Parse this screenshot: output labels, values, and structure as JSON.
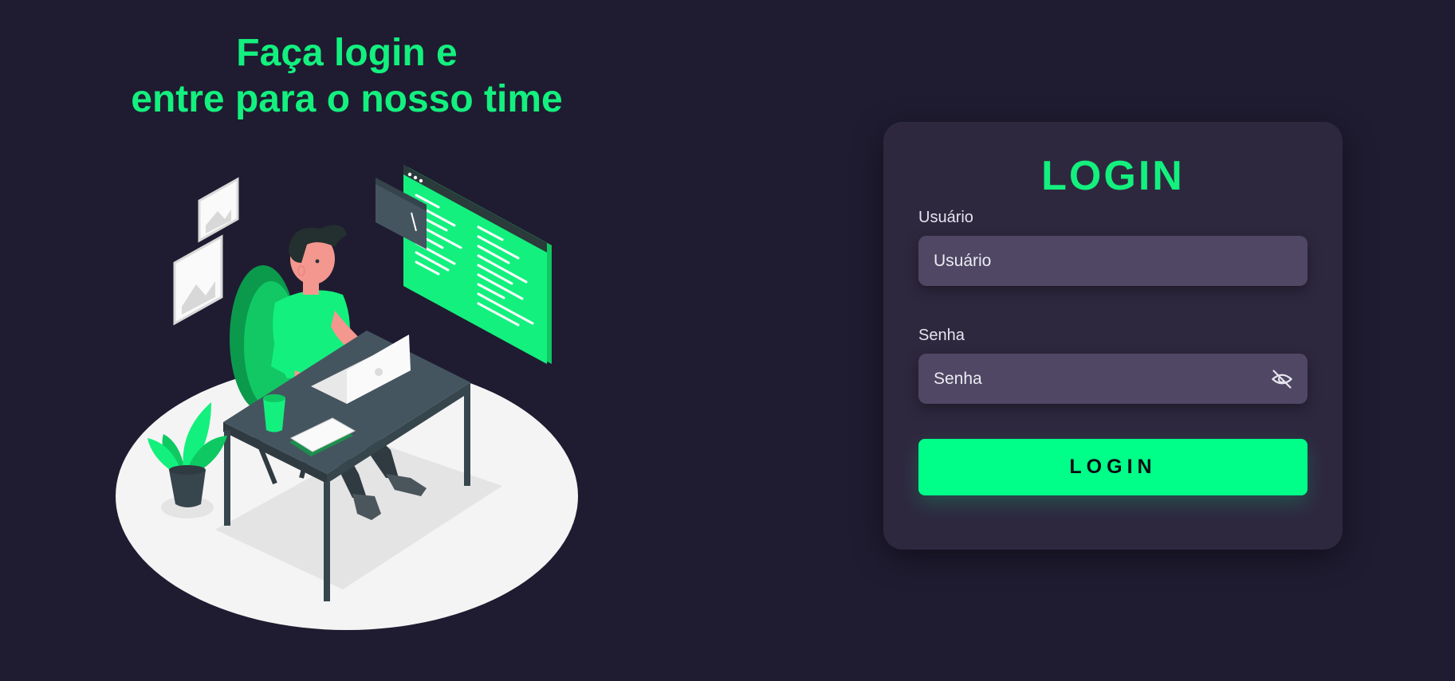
{
  "hero": {
    "line1": "Faça login e",
    "line2": "entre para o nosso time"
  },
  "login_card": {
    "title": "LOGIN",
    "username": {
      "label": "Usuário",
      "placeholder": "Usuário",
      "value": ""
    },
    "password": {
      "label": "Senha",
      "placeholder": "Senha",
      "value": "",
      "toggle_icon": "eye-off-icon"
    },
    "submit_label": "LOGIN"
  },
  "colors": {
    "background": "#1f1c31",
    "card": "#2e283f",
    "input": "#4f4764",
    "accent": "#13f07e",
    "button": "#00ff88"
  }
}
